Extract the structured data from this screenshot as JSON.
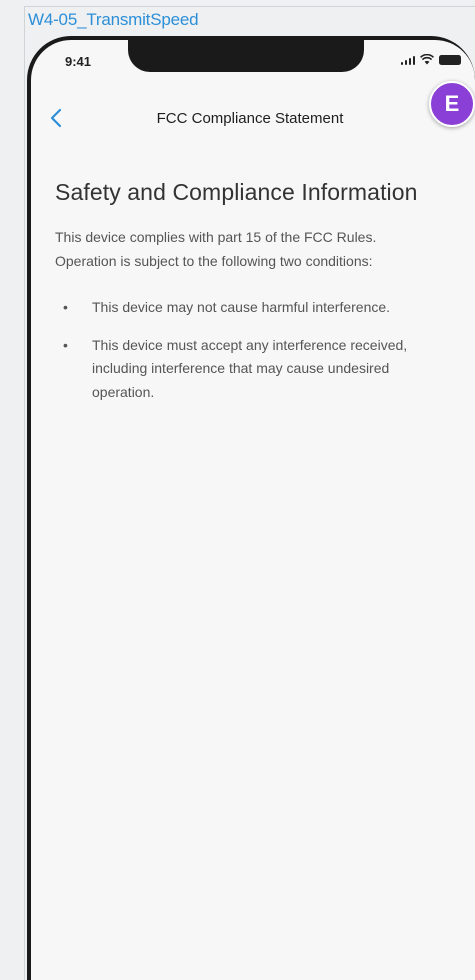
{
  "frame_label": "W4-05_TransmitSpeed",
  "status_bar": {
    "time": "9:41",
    "icons": [
      "signal-icon",
      "wifi-icon",
      "battery-icon"
    ]
  },
  "nav": {
    "back_icon": "chevron-left-icon",
    "title": "FCC Compliance Statement"
  },
  "avatar": {
    "initial": "E",
    "color": "#8a3fd6"
  },
  "content": {
    "heading": "Safety and Compliance Information",
    "intro": "This device complies with part 15 of the FCC Rules. Operation is subject to the following two conditions:",
    "bullets": [
      "This device may not cause harmful interference.",
      "This device must accept any interference received, including interference that may cause undesired operation."
    ]
  },
  "colors": {
    "accent": "#2c8fd8",
    "avatar": "#8a3fd6",
    "heading_text": "#333333",
    "body_text": "#555555",
    "background": "#f7f7f8"
  }
}
